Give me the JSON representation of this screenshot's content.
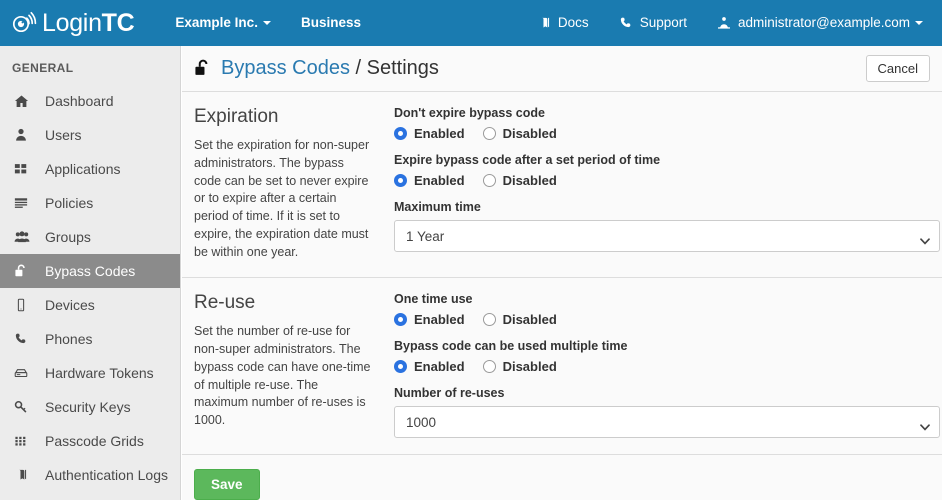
{
  "navbar": {
    "brand": {
      "text_light": "Login",
      "text_bold": "TC",
      "icon": "logintc-signal-icon"
    },
    "left_items": [
      {
        "label": "Example Inc.",
        "has_caret": true
      },
      {
        "label": "Business",
        "has_caret": false
      }
    ],
    "right_items": [
      {
        "label": "Docs",
        "icon": "book-icon",
        "has_caret": false
      },
      {
        "label": "Support",
        "icon": "phone-icon",
        "has_caret": false
      },
      {
        "label": "administrator@example.com",
        "icon": "user-admin-icon",
        "has_caret": true
      }
    ],
    "background_color": "#1a7bb0"
  },
  "sidebar": {
    "heading": "GENERAL",
    "active_color": "#8b8b8b",
    "items": [
      {
        "label": "Dashboard",
        "icon": "home-icon",
        "active": false
      },
      {
        "label": "Users",
        "icon": "user-icon",
        "active": false
      },
      {
        "label": "Applications",
        "icon": "grid-squares-icon",
        "active": false
      },
      {
        "label": "Policies",
        "icon": "list-lines-icon",
        "active": false
      },
      {
        "label": "Groups",
        "icon": "users-group-icon",
        "active": false
      },
      {
        "label": "Bypass Codes",
        "icon": "unlock-icon",
        "active": true
      },
      {
        "label": "Devices",
        "icon": "mobile-icon",
        "active": false
      },
      {
        "label": "Phones",
        "icon": "phone-icon",
        "active": false
      },
      {
        "label": "Hardware Tokens",
        "icon": "hardware-token-icon",
        "active": false
      },
      {
        "label": "Security Keys",
        "icon": "key-icon",
        "active": false
      },
      {
        "label": "Passcode Grids",
        "icon": "grid-dots-icon",
        "active": false
      },
      {
        "label": "Authentication Logs",
        "icon": "book-icon",
        "active": false
      }
    ]
  },
  "page": {
    "lock_icon": "unlock-icon",
    "breadcrumb_link": "Bypass Codes",
    "breadcrumb_separator": "/",
    "breadcrumb_current": "Settings",
    "cancel_label": "Cancel",
    "save_label": "Save",
    "save_color": "#5cb85c"
  },
  "sections": [
    {
      "title": "Expiration",
      "description": "Set the expiration for non-super administrators. The bypass code can be set to never expire or to expire after a certain period of time. If it is set to expire, the expiration date must be within one year.",
      "fields": [
        {
          "type": "radio",
          "label": "Don't expire bypass code",
          "options": [
            {
              "label": "Enabled",
              "selected": true
            },
            {
              "label": "Disabled",
              "selected": false
            }
          ]
        },
        {
          "type": "radio",
          "label": "Expire bypass code after a set period of time",
          "options": [
            {
              "label": "Enabled",
              "selected": true
            },
            {
              "label": "Disabled",
              "selected": false
            }
          ]
        },
        {
          "type": "select",
          "label": "Maximum time",
          "value": "1 Year"
        }
      ]
    },
    {
      "title": "Re-use",
      "description": "Set the number of re-use for non-super administrators. The bypass code can have one-time of multiple re-use. The maximum number of re-uses is 1000.",
      "fields": [
        {
          "type": "radio",
          "label": "One time use",
          "options": [
            {
              "label": "Enabled",
              "selected": true
            },
            {
              "label": "Disabled",
              "selected": false
            }
          ]
        },
        {
          "type": "radio",
          "label": "Bypass code can be used multiple time",
          "options": [
            {
              "label": "Enabled",
              "selected": true
            },
            {
              "label": "Disabled",
              "selected": false
            }
          ]
        },
        {
          "type": "select",
          "label": "Number of re-uses",
          "value": "1000"
        }
      ]
    }
  ]
}
